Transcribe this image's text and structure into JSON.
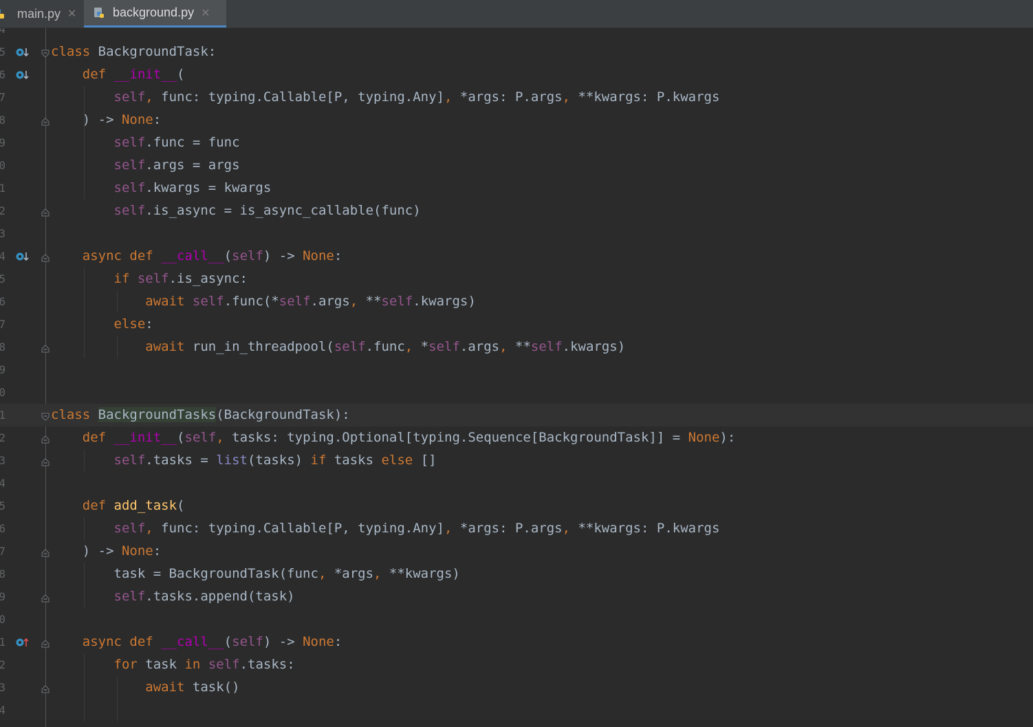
{
  "tabs": [
    {
      "label": "main.py",
      "active": false,
      "icon": "python-file-icon"
    },
    {
      "label": "background.py",
      "active": true,
      "icon": "python-file-icon"
    }
  ],
  "colors": {
    "background": "#2b2b2b",
    "keyword": "#cc7832",
    "self": "#94558d",
    "magic": "#b200b2",
    "function": "#ffc66d",
    "builtin": "#8888c6",
    "default_text": "#a9b7c6",
    "tab_accent": "#4a88c7"
  },
  "line_numbers": [
    "4",
    "5",
    "6",
    "7",
    "8",
    "9",
    "0",
    "1",
    "2",
    "3",
    "4",
    "5",
    "6",
    "7",
    "8",
    "9",
    "0",
    "1",
    "2",
    "3",
    "4",
    "5",
    "6",
    "7",
    "8",
    "9",
    "0",
    "1",
    "2",
    "3",
    "4"
  ],
  "current_line_index": 17,
  "gutter_markers": [
    {
      "line_index": 1,
      "icon": "implemented-down-icon"
    },
    {
      "line_index": 2,
      "icon": "implemented-down-icon"
    },
    {
      "line_index": 10,
      "icon": "implemented-down-icon"
    },
    {
      "line_index": 27,
      "icon": "overrides-up-icon"
    }
  ],
  "code_lines": [
    [],
    [
      [
        "kw",
        "class "
      ],
      [
        "",
        "BackgroundTask:"
      ]
    ],
    [
      [
        "",
        "    "
      ],
      [
        "kw",
        "def "
      ],
      [
        "mg",
        "__init__"
      ],
      [
        "",
        "("
      ]
    ],
    [
      [
        "",
        "        "
      ],
      [
        "slf",
        "self"
      ],
      [
        "kw",
        ", "
      ],
      [
        "",
        "func: typing.Callable[P, typing.Any]"
      ],
      [
        "kw",
        ", "
      ],
      [
        "",
        "*args: P.args"
      ],
      [
        "kw",
        ", "
      ],
      [
        "",
        "**kwargs: P.kwargs"
      ]
    ],
    [
      [
        "",
        "    ) -> "
      ],
      [
        "kw",
        "None"
      ],
      [
        "",
        ":"
      ]
    ],
    [
      [
        "",
        "        "
      ],
      [
        "slf",
        "self"
      ],
      [
        "",
        ".func = func"
      ]
    ],
    [
      [
        "",
        "        "
      ],
      [
        "slf",
        "self"
      ],
      [
        "",
        ".args = args"
      ]
    ],
    [
      [
        "",
        "        "
      ],
      [
        "slf",
        "self"
      ],
      [
        "",
        ".kwargs = kwargs"
      ]
    ],
    [
      [
        "",
        "        "
      ],
      [
        "slf",
        "self"
      ],
      [
        "",
        ".is_async = is_async_callable(func)"
      ]
    ],
    [],
    [
      [
        "",
        "    "
      ],
      [
        "kw",
        "async def "
      ],
      [
        "mg",
        "__call__"
      ],
      [
        "",
        "("
      ],
      [
        "slf",
        "self"
      ],
      [
        "",
        ") -> "
      ],
      [
        "kw",
        "None"
      ],
      [
        "",
        ":"
      ]
    ],
    [
      [
        "",
        "        "
      ],
      [
        "kw",
        "if "
      ],
      [
        "slf",
        "self"
      ],
      [
        "",
        ".is_async:"
      ]
    ],
    [
      [
        "",
        "            "
      ],
      [
        "kw",
        "await "
      ],
      [
        "slf",
        "self"
      ],
      [
        "",
        ".func(*"
      ],
      [
        "slf",
        "self"
      ],
      [
        "",
        ".args"
      ],
      [
        "kw",
        ", "
      ],
      [
        "",
        "**"
      ],
      [
        "slf",
        "self"
      ],
      [
        "",
        ".kwargs)"
      ]
    ],
    [
      [
        "",
        "        "
      ],
      [
        "kw",
        "else"
      ],
      [
        "",
        ":"
      ]
    ],
    [
      [
        "",
        "            "
      ],
      [
        "kw",
        "await "
      ],
      [
        "",
        "run_in_threadpool("
      ],
      [
        "slf",
        "self"
      ],
      [
        "",
        ".func"
      ],
      [
        "kw",
        ", "
      ],
      [
        "",
        "*"
      ],
      [
        "slf",
        "self"
      ],
      [
        "",
        ".args"
      ],
      [
        "kw",
        ", "
      ],
      [
        "",
        "**"
      ],
      [
        "slf",
        "self"
      ],
      [
        "",
        ".kwargs)"
      ]
    ],
    [],
    [],
    [
      [
        "kw",
        "class "
      ],
      [
        "hl",
        "BackgroundTasks"
      ],
      [
        "",
        "(BackgroundTask):"
      ]
    ],
    [
      [
        "",
        "    "
      ],
      [
        "kw",
        "def "
      ],
      [
        "mg",
        "__init__"
      ],
      [
        "",
        "("
      ],
      [
        "slf",
        "self"
      ],
      [
        "kw",
        ", "
      ],
      [
        "",
        "tasks: typing.Optional[typing.Sequence[BackgroundTask]] = "
      ],
      [
        "kw",
        "None"
      ],
      [
        "",
        "):"
      ]
    ],
    [
      [
        "",
        "        "
      ],
      [
        "slf",
        "self"
      ],
      [
        "",
        ".tasks = "
      ],
      [
        "bi",
        "list"
      ],
      [
        "",
        "(tasks) "
      ],
      [
        "kw",
        "if "
      ],
      [
        "",
        "tasks "
      ],
      [
        "kw",
        "else "
      ],
      [
        "",
        "[]"
      ]
    ],
    [],
    [
      [
        "",
        "    "
      ],
      [
        "kw",
        "def "
      ],
      [
        "fn",
        "add_task"
      ],
      [
        "",
        "("
      ]
    ],
    [
      [
        "",
        "        "
      ],
      [
        "slf",
        "self"
      ],
      [
        "kw",
        ", "
      ],
      [
        "",
        "func: typing.Callable[P, typing.Any]"
      ],
      [
        "kw",
        ", "
      ],
      [
        "",
        "*args: P.args"
      ],
      [
        "kw",
        ", "
      ],
      [
        "",
        "**kwargs: P.kwargs"
      ]
    ],
    [
      [
        "",
        "    ) -> "
      ],
      [
        "kw",
        "None"
      ],
      [
        "",
        ":"
      ]
    ],
    [
      [
        "",
        "        task = BackgroundTask(func"
      ],
      [
        "kw",
        ", "
      ],
      [
        "",
        "*args"
      ],
      [
        "kw",
        ", "
      ],
      [
        "",
        "**kwargs)"
      ]
    ],
    [
      [
        "",
        "        "
      ],
      [
        "slf",
        "self"
      ],
      [
        "",
        ".tasks.append(task)"
      ]
    ],
    [],
    [
      [
        "",
        "    "
      ],
      [
        "kw",
        "async def "
      ],
      [
        "mg",
        "__call__"
      ],
      [
        "",
        "("
      ],
      [
        "slf",
        "self"
      ],
      [
        "",
        ") -> "
      ],
      [
        "kw",
        "None"
      ],
      [
        "",
        ":"
      ]
    ],
    [
      [
        "",
        "        "
      ],
      [
        "kw",
        "for "
      ],
      [
        "",
        "task "
      ],
      [
        "kw",
        "in "
      ],
      [
        "slf",
        "self"
      ],
      [
        "",
        ".tasks:"
      ]
    ],
    [
      [
        "",
        "            "
      ],
      [
        "kw",
        "await "
      ],
      [
        "",
        "task()"
      ]
    ],
    []
  ]
}
